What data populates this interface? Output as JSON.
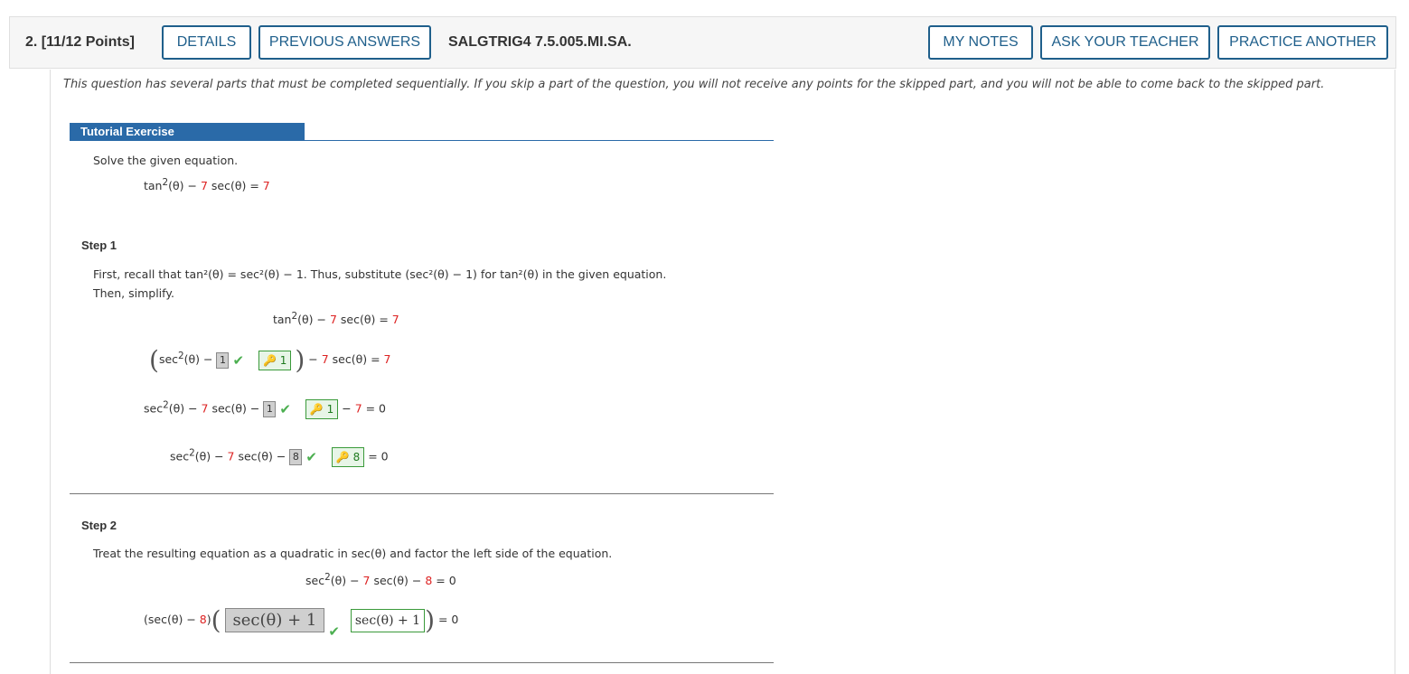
{
  "header": {
    "question_number": "2.",
    "points": "[11/12 Points]",
    "details_label": "DETAILS",
    "previous_answers_label": "PREVIOUS ANSWERS",
    "question_id": "SALGTRIG4 7.5.005.MI.SA.",
    "my_notes_label": "MY NOTES",
    "ask_teacher_label": "ASK YOUR TEACHER",
    "practice_another_label": "PRACTICE ANOTHER"
  },
  "intro": "This question has several parts that must be completed sequentially. If you skip a part of the question, you will not receive any points for the skipped part, and you will not be able to come back to the skipped part.",
  "tutorial": {
    "title": "Tutorial Exercise",
    "prompt": "Solve the given equation.",
    "equation": {
      "lhs_a": "tan",
      "sup": "2",
      "lhs_b": "(θ) − ",
      "coef": "7",
      "lhs_c": " sec(θ) = ",
      "rhs": "7"
    }
  },
  "step1": {
    "title": "Step 1",
    "text_line1": "First, recall that  tan²(θ) = sec²(θ) − 1.  Thus, substitute  (sec²(θ) − 1)  for  tan²(θ)  in the given equation.",
    "text_line2": "Then, simplify.",
    "row1": {
      "a": "tan",
      "sup": "2",
      "b": "(θ) − ",
      "coef": "7",
      "c": " sec(θ)  = ",
      "rhs": "7"
    },
    "row2": {
      "a": "sec",
      "sup": "2",
      "b": "(θ) − ",
      "entered": "1",
      "answer": "1",
      "c": " − ",
      "coef": "7",
      "d": " sec(θ)  = ",
      "rhs": "7"
    },
    "row3": {
      "a": "sec",
      "sup": "2",
      "b": "(θ) − ",
      "coef": "7",
      "c": " sec(θ) − ",
      "entered": "1",
      "answer": "1",
      "d": " − ",
      "coef2": "7",
      "e": "  =  0"
    },
    "row4": {
      "a": "sec",
      "sup": "2",
      "b": "(θ) − ",
      "coef": "7",
      "c": " sec(θ) − ",
      "entered": "8",
      "answer": "8",
      "e": "  =  0"
    }
  },
  "step2": {
    "title": "Step 2",
    "text": "Treat the resulting equation as a quadratic in  sec(θ)  and factor the left side of the equation.",
    "eq": {
      "a": "sec",
      "sup": "2",
      "b": "(θ) − ",
      "coef": "7",
      "c": " sec(θ) − ",
      "coef2": "8",
      "d": "  =  0"
    },
    "factor": {
      "a": "(sec(θ) − ",
      "coef": "8",
      "b": ")",
      "entered": "sec(θ) + 1",
      "answer": "sec(θ) + 1",
      "c": "  =  0"
    }
  },
  "icons": {
    "check": "check-icon",
    "key": "key-icon"
  },
  "colors": {
    "accent": "#1f5f8b",
    "tutorial_bar": "#2a6aa8",
    "red": "#dd2222",
    "correct": "#4caf50"
  }
}
